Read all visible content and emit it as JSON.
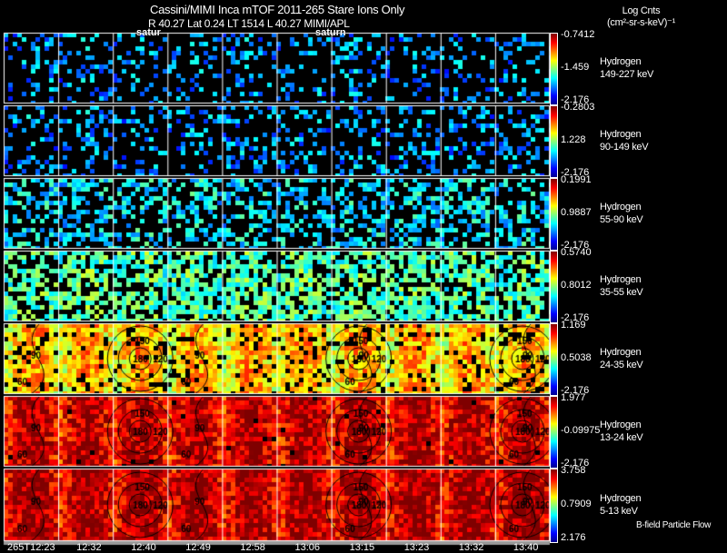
{
  "header": {
    "title": "Cassini/MIMI Inca mTOF  2011-265    Stare    Ions Only",
    "subtitle": "R          40.27 Lat 0.24 LT 1514 L          40.27  MIMI/APL",
    "overlay_labels": [
      "satur",
      "saturn"
    ]
  },
  "colorbar_title": {
    "line1": "Log Cnts",
    "line2": "(cm²-sr-s-keV)⁻¹"
  },
  "footer_note": "B-field Particle Flow",
  "chart_data": {
    "type": "heatmap",
    "colormap": "jet",
    "x_tick_labels": [
      "265T12:23",
      "12:32",
      "12:40",
      "12:49",
      "12:58",
      "13:06",
      "13:15",
      "13:23",
      "13:32",
      "13:40"
    ],
    "contour_labels": [
      "60",
      "90",
      "120",
      "150",
      "180"
    ],
    "panels": [
      {
        "species": "Hydrogen",
        "energy": "149-227 keV",
        "cb_max": "-0.7412",
        "cb_mid": "-1.459",
        "cb_min": "-2.176"
      },
      {
        "species": "Hydrogen",
        "energy": "90-149 keV",
        "cb_max": "-0.2803",
        "cb_mid": "1.228",
        "cb_min": "-2.176"
      },
      {
        "species": "Hydrogen",
        "energy": "55-90 keV",
        "cb_max": "0.1991",
        "cb_mid": "0.9887",
        "cb_min": "-2.176"
      },
      {
        "species": "Hydrogen",
        "energy": "35-55 keV",
        "cb_max": "0.5740",
        "cb_mid": "0.8012",
        "cb_min": "-2.176"
      },
      {
        "species": "Hydrogen",
        "energy": "24-35 keV",
        "cb_max": "1.169",
        "cb_mid": "0.5038",
        "cb_min": "-2.176"
      },
      {
        "species": "Hydrogen",
        "energy": "13-24 keV",
        "cb_max": "1.977",
        "cb_mid": "-0.09975",
        "cb_min": "-2.176"
      },
      {
        "species": "Hydrogen",
        "energy": "5-13 keV",
        "cb_max": "3.758",
        "cb_mid": "0.7909",
        "cb_min": "2.176"
      }
    ]
  }
}
